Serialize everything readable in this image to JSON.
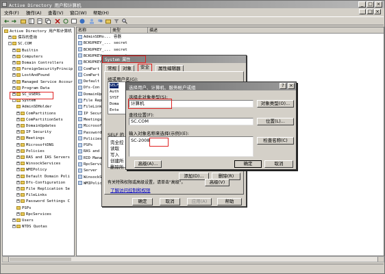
{
  "window": {
    "title": "Active Directory 用户和计算机"
  },
  "titlebar_buttons": [
    "_",
    "□",
    "×"
  ],
  "menu": [
    "文件(F)",
    "操作(A)",
    "查看(V)",
    "窗口(W)",
    "帮助(H)"
  ],
  "inner_window_buttons": [
    "_",
    "□",
    "×"
  ],
  "tree": [
    {
      "label": "Active Directory 用户和计算机",
      "indent": 0,
      "exp": ""
    },
    {
      "label": "保存的查询",
      "indent": 1,
      "exp": "+"
    },
    {
      "label": "SC.COM",
      "indent": 1,
      "exp": "-"
    },
    {
      "label": "Builtin",
      "indent": 2,
      "exp": "+"
    },
    {
      "label": "Computers",
      "indent": 2,
      "exp": "+"
    },
    {
      "label": "Domain Controllers",
      "indent": 2,
      "exp": "+"
    },
    {
      "label": "ForeignSecurityPrincip",
      "indent": 2,
      "exp": "+"
    },
    {
      "label": "LostAndFound",
      "indent": 2,
      "exp": "+"
    },
    {
      "label": "Managed Service Accour",
      "indent": 2,
      "exp": "+"
    },
    {
      "label": "Program Data",
      "indent": 2,
      "exp": "+"
    },
    {
      "label": "SC_USERS",
      "indent": 2,
      "exp": "+"
    },
    {
      "label": "System",
      "indent": 2,
      "exp": "-"
    },
    {
      "label": "AdminSDHolder",
      "indent": 3,
      "exp": ""
    },
    {
      "label": "ComPartitions",
      "indent": 3,
      "exp": "+"
    },
    {
      "label": "ComPartitionSets",
      "indent": 3,
      "exp": "+"
    },
    {
      "label": "DomainUpdates",
      "indent": 3,
      "exp": "+"
    },
    {
      "label": "IP Security",
      "indent": 3,
      "exp": "+"
    },
    {
      "label": "Meetings",
      "indent": 3,
      "exp": "+"
    },
    {
      "label": "MicrosoftDNS",
      "indent": 3,
      "exp": "+"
    },
    {
      "label": "Policies",
      "indent": 3,
      "exp": "+"
    },
    {
      "label": "RAS and IAS Servers",
      "indent": 3,
      "exp": "+"
    },
    {
      "label": "WinsockServices",
      "indent": 3,
      "exp": "+"
    },
    {
      "label": "WMIPolicy",
      "indent": 3,
      "exp": "+"
    },
    {
      "label": "Default Domain Poli",
      "indent": 3,
      "exp": "+"
    },
    {
      "label": "Dfs-Configuration",
      "indent": 3,
      "exp": "+"
    },
    {
      "label": "File Replication Se",
      "indent": 3,
      "exp": "+"
    },
    {
      "label": "FileLinks",
      "indent": 3,
      "exp": "+"
    },
    {
      "label": "Password Settings C",
      "indent": 3,
      "exp": "+"
    },
    {
      "label": "PSPs",
      "indent": 3,
      "exp": ""
    },
    {
      "label": "RpcServices",
      "indent": 3,
      "exp": "+"
    },
    {
      "label": "Users",
      "indent": 2,
      "exp": "+"
    },
    {
      "label": "NTDS Quotas",
      "indent": 2,
      "exp": "+"
    }
  ],
  "list": {
    "headers": [
      "名称",
      "类型",
      "描述"
    ],
    "rows": [
      {
        "name": "AdminSDHo...",
        "type": "容器"
      },
      {
        "name": "BCKUPKEY_...",
        "type": "secret"
      },
      {
        "name": "BCKUPKEY_...",
        "type": "secret"
      },
      {
        "name": "BCKUPKEY_...",
        "type": "secret"
      },
      {
        "name": "BCKUPKEY_...",
        "type": "secret"
      },
      {
        "name": "ComPart",
        "type": ""
      },
      {
        "name": "ComPart",
        "type": ""
      },
      {
        "name": "Default",
        "type": ""
      },
      {
        "name": "Dfs-Con",
        "type": ""
      },
      {
        "name": "DomainUp",
        "type": ""
      },
      {
        "name": "File Rep",
        "type": ""
      },
      {
        "name": "FileLink",
        "type": ""
      },
      {
        "name": "IP Secur",
        "type": ""
      },
      {
        "name": "Meetings",
        "type": ""
      },
      {
        "name": "Microsof",
        "type": ""
      },
      {
        "name": "Password",
        "type": ""
      },
      {
        "name": "Policies",
        "type": ""
      },
      {
        "name": "PSPs",
        "type": ""
      },
      {
        "name": "RAS and",
        "type": ""
      },
      {
        "name": "RID Mana",
        "type": ""
      },
      {
        "name": "RpcServi",
        "type": ""
      },
      {
        "name": "Server",
        "type": ""
      },
      {
        "name": "WinsockS",
        "type": ""
      },
      {
        "name": "WMIPolic",
        "type": ""
      }
    ]
  },
  "props": {
    "title": "System 属性",
    "tabs": [
      "常规",
      "对象",
      "安全",
      "属性编辑器"
    ],
    "group_label": "组或用户名(G):",
    "groups": [
      "SELF",
      "Auth",
      "SYST",
      "Doma",
      "Ente"
    ],
    "perm_label": "SELF 的",
    "perms": [
      "完全控",
      "读取",
      "写入",
      "创建所",
      "删除所"
    ],
    "add_button": "添加(D)...",
    "remove_button": "删除(R)",
    "advanced_button": "高级(V)",
    "footer_text": "有关特殊权限或高级设置，请单击\"高级\"。",
    "link": "了解访问控制和权限",
    "ok": "确定",
    "cancel": "取消",
    "apply": "应用(A)",
    "help": "帮助"
  },
  "select": {
    "title": "选择用户、计算机、服务帐户或组",
    "close": "?",
    "type_label": "选择此对象类型(S):",
    "type_value": "计算机",
    "type_button": "对象类型(O)...",
    "loc_label": "查找位置(F):",
    "loc_value": "SC.COM",
    "loc_button": "位置(L)...",
    "name_label": "输入对象名称来选择(示例)(E):",
    "name_value": "SC-2008",
    "check_button": "检查名称(C)",
    "advanced": "高级(A)...",
    "ok": "确定",
    "cancel": "取消"
  },
  "colors": {
    "highlight": "#e02020",
    "title_gradient": "#7b7b7b"
  }
}
